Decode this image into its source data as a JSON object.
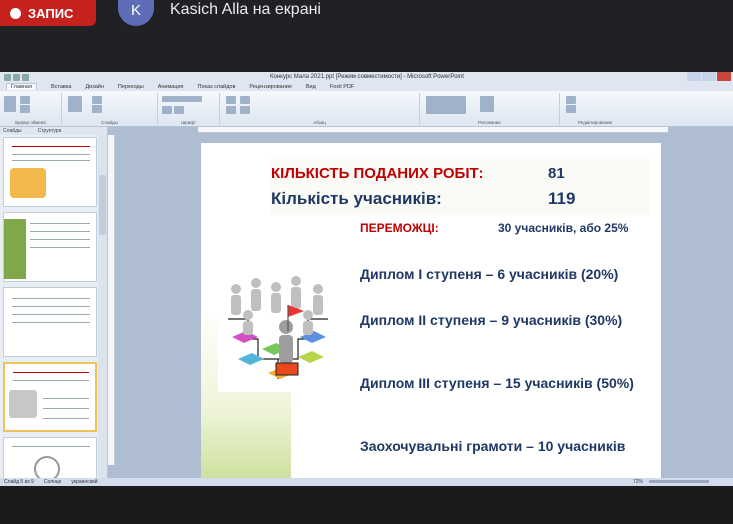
{
  "meeting": {
    "recording_label": "ЗАПИС",
    "avatar_letter": "K",
    "presenter_text": "Kasich Alla на екрані"
  },
  "app": {
    "window_title": "Конкурс Мала 2021.ppt [Режим совместимости] - Microsoft PowerPoint",
    "tabs": [
      "Главная",
      "Вставка",
      "Дизайн",
      "Переходы",
      "Анимация",
      "Показ слайдов",
      "Рецензирование",
      "Вид",
      "Foxit PDF"
    ],
    "ribbon_groups": [
      "Буфер обмена",
      "Слайды",
      "Шрифт",
      "Абзац",
      "Рисование",
      "Редактирование"
    ],
    "pane_tabs": [
      "Слайды",
      "Структура"
    ],
    "status_slide": "Слайд 5 из 9",
    "status_theme": "Солнце",
    "status_lang": "украинский",
    "zoom": "72%"
  },
  "slide": {
    "line1_label": "КІЛЬКІСТЬ ПОДАНИХ РОБІТ:",
    "line1_value": "81",
    "line2_label": "Кількість учасників:",
    "line2_value": "119",
    "winners_label": "ПЕРЕМОЖЦІ:",
    "winners_value": "30 учасників, або 25%",
    "items": [
      "Диплом І ступеня – 6 учасників (20%)",
      "Диплом ІІ ступеня – 9 учасників (30%)",
      "Диплом ІІІ ступеня – 15 учасників (50%)",
      "Заохочувальні грамоти – 10 учасників"
    ]
  },
  "colors": {
    "accent_red": "#c00000",
    "text_blue": "#1f3864",
    "record_red": "#c5221f"
  }
}
